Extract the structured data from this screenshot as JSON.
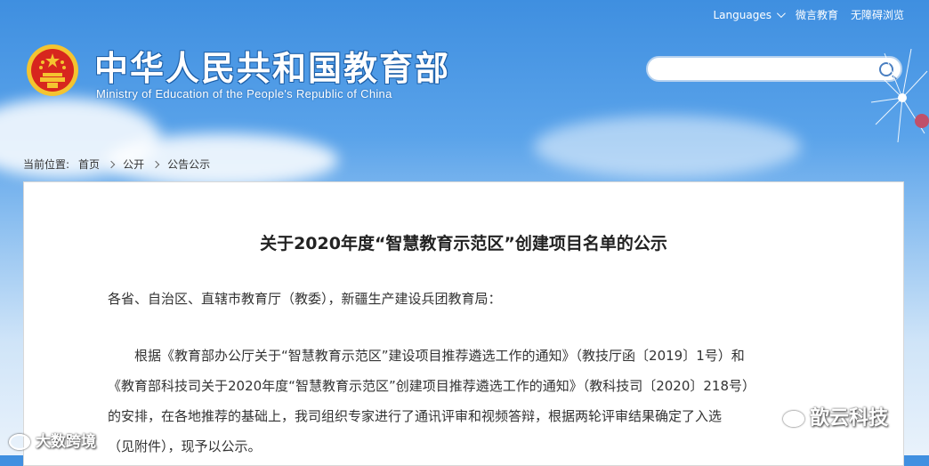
{
  "header": {
    "languages_label": "Languages",
    "weibo_label": "微言教育",
    "accessibility_label": "无障碍浏览",
    "site_title": "中华人民共和国教育部",
    "site_subtitle": "Ministry of Education of the People's Republic of China",
    "search_placeholder": ""
  },
  "breadcrumb": {
    "prefix": "当前位置:",
    "items": [
      "首页",
      "公开",
      "公告公示"
    ]
  },
  "document": {
    "title": "关于2020年度“智慧教育示范区”创建项目名单的公示",
    "salutation": "各省、自治区、直辖市教育厅（教委），新疆生产建设兵团教育局：",
    "body_line1": "根据《教育部办公厅关于“智慧教育示范区”建设项目推荐遴选工作的通知》（教技厅函〔2019〕1号）和",
    "body_line2": "《教育部科技司关于2020年度“智慧教育示范区”创建项目推荐遴选工作的通知》（教科技司〔2020〕218号）",
    "body_line3": "的安排，在各地推荐的基础上，我司组织专家进行了通讯评审和视频答辩，根据两轮评审结果确定了入选",
    "body_line4": "（见附件），现予以公示。"
  },
  "watermarks": {
    "left": "大数跨境",
    "right": "歆云科技"
  },
  "colors": {
    "sky_top": "#3f8fe0",
    "title_outline": "#1d5fa8",
    "emblem_red": "#d7261e",
    "emblem_gold": "#f4c430"
  }
}
